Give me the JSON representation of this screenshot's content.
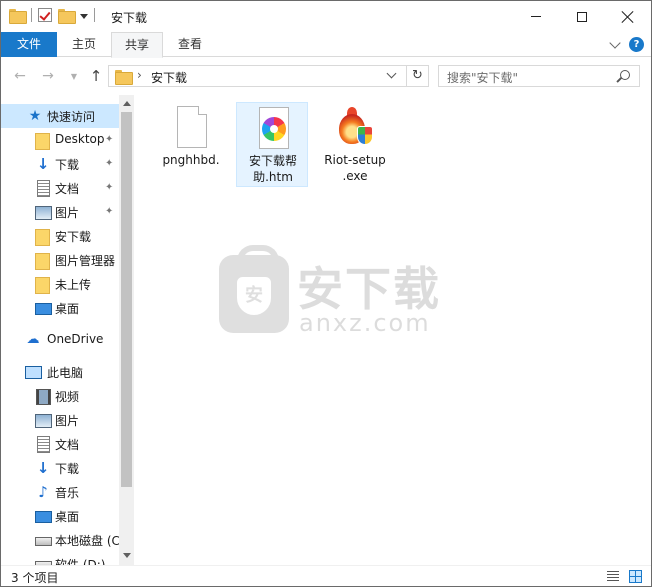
{
  "window": {
    "title": "安下载"
  },
  "ribbon": {
    "tabs": [
      {
        "label": "文件"
      },
      {
        "label": "主页"
      },
      {
        "label": "共享"
      },
      {
        "label": "查看"
      }
    ],
    "help_label": "?"
  },
  "nav": {
    "breadcrumb": "安下载",
    "breadcrumb_sep": "›",
    "search_placeholder": "搜索\"安下载\""
  },
  "sidebar": {
    "items": [
      {
        "label": "快速访问",
        "icon": "star-icon"
      },
      {
        "label": "Desktop",
        "icon": "folder-icon"
      },
      {
        "label": "下载",
        "icon": "download-icon"
      },
      {
        "label": "文档",
        "icon": "document-icon"
      },
      {
        "label": "图片",
        "icon": "picture-icon"
      },
      {
        "label": "安下载",
        "icon": "folder-icon"
      },
      {
        "label": "图片管理器",
        "icon": "folder-icon"
      },
      {
        "label": "未上传",
        "icon": "folder-icon"
      },
      {
        "label": "桌面",
        "icon": "desktop-icon"
      },
      {
        "label": "OneDrive",
        "icon": "cloud-icon"
      },
      {
        "label": "此电脑",
        "icon": "computer-icon"
      },
      {
        "label": "视频",
        "icon": "video-icon"
      },
      {
        "label": "图片",
        "icon": "picture-icon"
      },
      {
        "label": "文档",
        "icon": "document-icon"
      },
      {
        "label": "下载",
        "icon": "download-icon"
      },
      {
        "label": "音乐",
        "icon": "music-icon"
      },
      {
        "label": "桌面",
        "icon": "desktop-icon"
      },
      {
        "label": "本地磁盘 (C",
        "icon": "disk-icon"
      },
      {
        "label": "软件 (D:)",
        "icon": "disk-icon"
      }
    ]
  },
  "files": [
    {
      "name_line1": "pnghhbd.",
      "name_line2": "",
      "icon": "blank-file-icon"
    },
    {
      "name_line1": "安下载帮",
      "name_line2": "助.htm",
      "icon": "htm-file-icon"
    },
    {
      "name_line1": "Riot-setup",
      "name_line2": ".exe",
      "icon": "exe-file-icon"
    }
  ],
  "watermark": {
    "title": "安下载",
    "subtitle": "anxz.com",
    "badge": "安"
  },
  "status": {
    "item_count": "3 个项目"
  },
  "colors": {
    "accent": "#1979ca",
    "selection": "#cce8ff",
    "folder": "#f5c75c"
  }
}
